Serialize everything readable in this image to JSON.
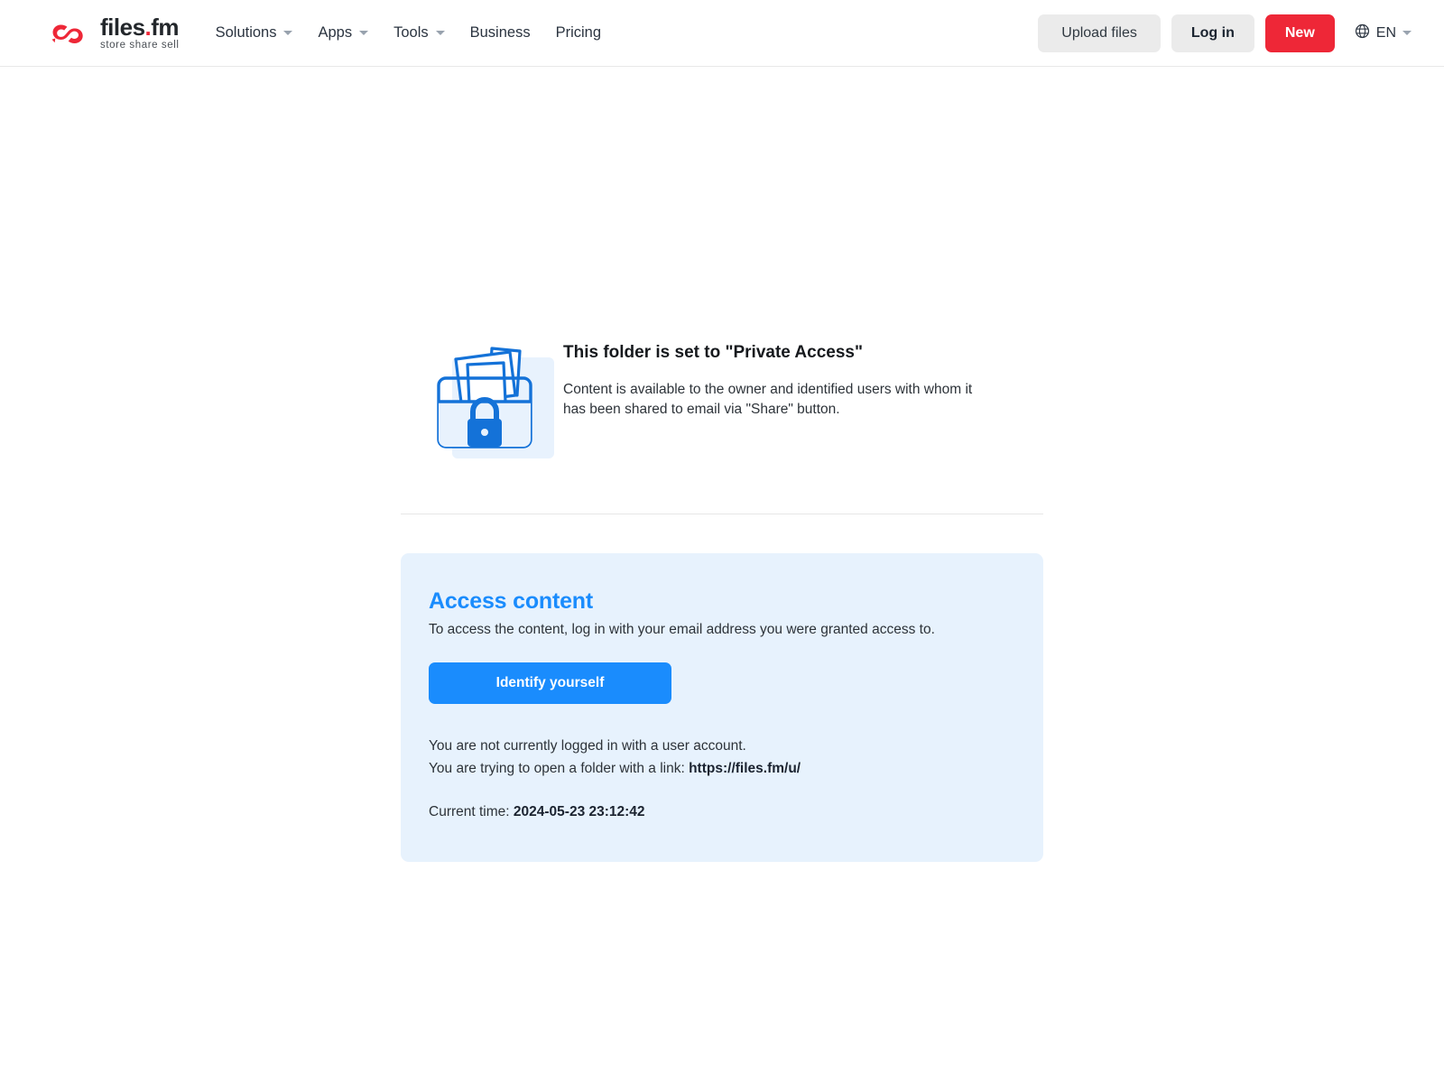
{
  "header": {
    "logo": {
      "icon": "files-fm-cloud-icon",
      "name": "files.fm",
      "name_main": "files",
      "name_dot": ".",
      "name_ext": "fm",
      "tagline": "store  share  sell"
    },
    "nav": [
      {
        "label": "Solutions",
        "has_dropdown": true
      },
      {
        "label": "Apps",
        "has_dropdown": true
      },
      {
        "label": "Tools",
        "has_dropdown": true
      },
      {
        "label": "Business",
        "has_dropdown": false
      },
      {
        "label": "Pricing",
        "has_dropdown": false
      }
    ],
    "upload_label": "Upload files",
    "login_label": "Log in",
    "new_label": "New",
    "language": {
      "icon": "globe-icon",
      "label": "EN"
    }
  },
  "notice": {
    "illustration": "locked-folder-icon",
    "title": "This folder is set to \"Private Access\"",
    "body": "Content is available to the owner and identified users with whom it has been shared to email via \"Share\" button."
  },
  "panel": {
    "title": "Access content",
    "subtitle": "To access the content, log in with your email address you were granted access to.",
    "identify_button": "Identify yourself",
    "status_line": "You are not currently logged in with a user account.",
    "link_prefix": "You are trying to open a folder with a link:",
    "link_url": "https://files.fm/u/",
    "time_label": "Current time:",
    "time_value": "2024-05-23 23:12:42"
  },
  "colors": {
    "brand_red": "#ee2737",
    "accent_blue": "#1a8cfd",
    "panel_bg": "#e7f2fd",
    "button_gray": "#ebebeb"
  }
}
